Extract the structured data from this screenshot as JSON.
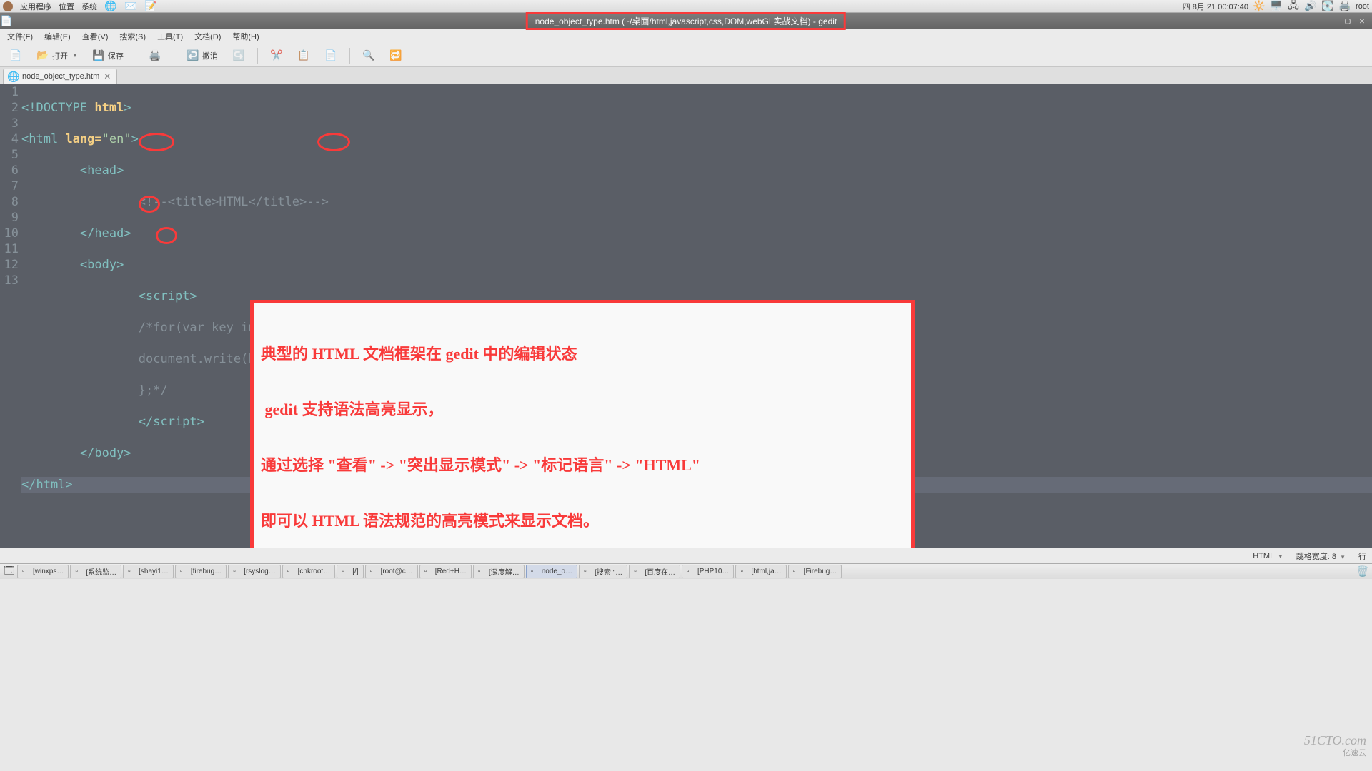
{
  "gnome_panel": {
    "apps": "应用程序",
    "places": "位置",
    "system": "系统",
    "datetime": "四  8月  21 00:07:40",
    "user": "root"
  },
  "window": {
    "title": "node_object_type.htm (~/桌面/html,javascript,css,DOM,webGL实战文档) - gedit"
  },
  "menubar": {
    "file": "文件(F)",
    "edit": "编辑(E)",
    "view": "查看(V)",
    "search": "搜索(S)",
    "tools": "工具(T)",
    "documents": "文档(D)",
    "help": "帮助(H)"
  },
  "toolbar": {
    "open": "打开",
    "save": "保存",
    "undo": "撤消"
  },
  "tab": {
    "filename": "node_object_type.htm"
  },
  "code": {
    "l1a": "<!DOCTYPE html>",
    "l4_title": "HTML",
    "l8": "for(var key in Node){",
    "l9": "document.write(key,' = '+Node[key]);"
  },
  "annotation": {
    "line1": "典型的 HTML 文档框架在 gedit 中的编辑状态",
    "line2": " gedit 支持语法高亮显示，",
    "line3": "通过选择 \"查看\" -> \"突出显示模式\" -> \"标记语言\" -> \"HTML\"",
    "line4": "即可以 HTML 语法规范的高亮模式来显示文档。"
  },
  "statusbar": {
    "lang": "HTML",
    "tabwidth": "跳格宽度:  8",
    "line_col": "行"
  },
  "taskbar": {
    "items": [
      "[winxps…",
      "[系统监…",
      "[shayi1…",
      "[firebug…",
      "[rsyslog…",
      "[chkroot…",
      "[/]",
      "[root@c…",
      "[Red+H…",
      "[深度解…",
      "node_o…",
      "[搜索 \"…",
      "[百度在…",
      "[PHP10…",
      "[html,ja…",
      "[Firebug…"
    ]
  },
  "watermark": {
    "w1": "51CTO.com",
    "w2": "亿速云"
  }
}
